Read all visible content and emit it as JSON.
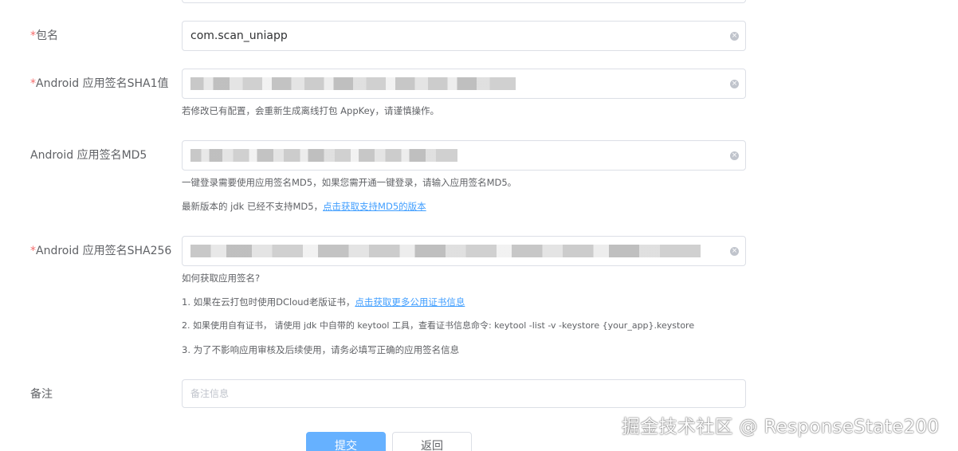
{
  "form": {
    "package": {
      "required_mark": "*",
      "label": "包名",
      "value": "com.scan_uniapp"
    },
    "sha1": {
      "required_mark": "*",
      "label": "Android 应用签名SHA1值",
      "help": "若修改已有配置，会重新生成离线打包 AppKey，请谨慎操作。"
    },
    "md5": {
      "label": "Android 应用签名MD5",
      "help1": "一键登录需要使用应用签名MD5，如果您需开通一键登录，请输入应用签名MD5。",
      "help2_text": "最新版本的 jdk 已经不支持MD5，",
      "help2_link": "点击获取支持MD5的版本"
    },
    "sha256": {
      "required_mark": "*",
      "label": "Android 应用签名SHA256",
      "help_title": "如何获取应用签名?",
      "tip1_text": "1. 如果在云打包时使用DCloud老版证书，",
      "tip1_link": "点击获取更多公用证书信息",
      "tip2": "2. 如果使用自有证书， 请使用 jdk 中自带的 keytool 工具，查看证书信息命令: keytool -list -v -keystore {your_app}.keystore",
      "tip3": "3. 为了不影响应用审核及后续使用，请务必填写正确的应用签名信息"
    },
    "remark": {
      "label": "备注",
      "placeholder": "备注信息"
    }
  },
  "buttons": {
    "submit": "提交",
    "back": "返回"
  },
  "icons": {
    "clear": "circle-close-icon"
  },
  "colors": {
    "required": "#f56c6c",
    "link": "#409eff",
    "primary": "#66b1ff"
  },
  "watermark": "掘金技术社区 @ ResponseState200"
}
